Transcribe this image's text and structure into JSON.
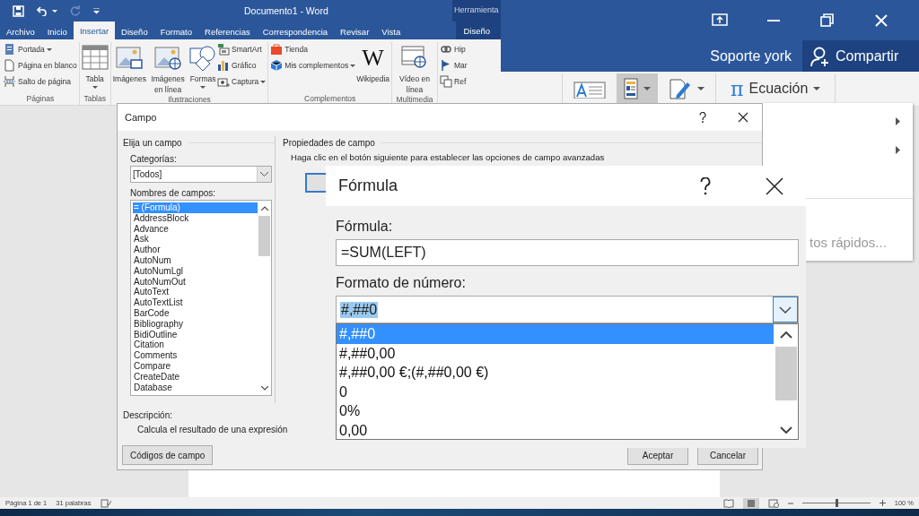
{
  "window": {
    "title": "Documento1 - Word",
    "context_group": "Herramienta"
  },
  "ribbon_tabs": [
    {
      "label": "Archivo",
      "selected": false
    },
    {
      "label": "Inicio",
      "selected": false
    },
    {
      "label": "Insertar",
      "selected": true
    },
    {
      "label": "Diseño",
      "selected": false
    },
    {
      "label": "Formato",
      "selected": false
    },
    {
      "label": "Referencias",
      "selected": false
    },
    {
      "label": "Correspondencia",
      "selected": false
    },
    {
      "label": "Revisar",
      "selected": false
    },
    {
      "label": "Vista",
      "selected": false
    },
    {
      "label": "Diseño",
      "selected": false,
      "kind": "contextual"
    }
  ],
  "account": {
    "user": "Soporte york",
    "share": "Compartir"
  },
  "ribbon_groups": [
    {
      "label": "Páginas",
      "commands": [
        {
          "label": "Portada",
          "kind": "small",
          "menu": true
        },
        {
          "label": "Página en blanco",
          "kind": "small",
          "menu": false
        },
        {
          "label": "Salto de página",
          "kind": "small",
          "menu": false
        }
      ]
    },
    {
      "label": "Tablas",
      "commands": [
        {
          "label": "Tabla",
          "kind": "large",
          "menu": true
        }
      ]
    },
    {
      "label": "Ilustraciones",
      "commands": [
        {
          "label": "Imágenes",
          "kind": "large",
          "menu": false
        },
        {
          "label": "Imágenes en línea",
          "kind": "large",
          "menu": false
        },
        {
          "label": "Formas",
          "kind": "large",
          "menu": true
        },
        {
          "label": "SmartArt",
          "kind": "small",
          "menu": false
        },
        {
          "label": "Gráfico",
          "kind": "small",
          "menu": false
        },
        {
          "label": "Captura",
          "kind": "small",
          "menu": true
        }
      ]
    },
    {
      "label": "Complementos",
      "commands": [
        {
          "label": "Tienda",
          "kind": "small",
          "menu": false
        },
        {
          "label": "Mis complementos",
          "kind": "small",
          "menu": true
        },
        {
          "label": "Wikipedia",
          "kind": "logo",
          "logo": "W",
          "menu": false
        }
      ]
    },
    {
      "label": "Multimedia",
      "commands": [
        {
          "label": "Vídeo en línea",
          "kind": "large",
          "menu": false
        }
      ]
    },
    {
      "commands": [
        {
          "label": "Hip",
          "kind": "small",
          "menu": false
        },
        {
          "label": "Mar",
          "kind": "small",
          "menu": false
        },
        {
          "label": "Ref",
          "kind": "small",
          "menu": false
        }
      ]
    }
  ],
  "equation": {
    "symbol": "π",
    "label": "Ecuación"
  },
  "side_menu": {
    "partial_item": "tos rápidos..."
  },
  "campo_dialog": {
    "title": "Campo",
    "choose_heading": "Elija un campo",
    "categories_label": "Categorías:",
    "categories_value": "[Todos]",
    "names_label": "Nombres de campos:",
    "field_names": [
      {
        "label": "= (Formula)",
        "selected": true
      },
      {
        "label": "AddressBlock",
        "selected": false
      },
      {
        "label": "Advance",
        "selected": false
      },
      {
        "label": "Ask",
        "selected": false
      },
      {
        "label": "Author",
        "selected": false
      },
      {
        "label": "AutoNum",
        "selected": false
      },
      {
        "label": "AutoNumLgl",
        "selected": false
      },
      {
        "label": "AutoNumOut",
        "selected": false
      },
      {
        "label": "AutoText",
        "selected": false
      },
      {
        "label": "AutoTextList",
        "selected": false
      },
      {
        "label": "BarCode",
        "selected": false
      },
      {
        "label": "Bibliography",
        "selected": false
      },
      {
        "label": "BidiOutline",
        "selected": false
      },
      {
        "label": "Citation",
        "selected": false
      },
      {
        "label": "Comments",
        "selected": false
      },
      {
        "label": "Compare",
        "selected": false
      },
      {
        "label": "CreateDate",
        "selected": false
      },
      {
        "label": "Database",
        "selected": false
      }
    ],
    "description_label": "Descripción:",
    "description": "Calcula el resultado de una expresión",
    "field_codes_button": "Códigos de campo",
    "properties_heading": "Propiedades de campo",
    "properties_hint": "Haga clic en el botón siguiente para establecer las opciones de campo avanzadas",
    "buttons": [
      "Aceptar",
      "Cancelar"
    ]
  },
  "formula_dialog": {
    "title": "Fórmula",
    "formula_label": "Fórmula:",
    "formula_value": "=SUM(LEFT)",
    "number_format_label": "Formato de número:",
    "number_format_value": "#,##0",
    "number_formats": [
      {
        "label": "#,##0",
        "selected": true
      },
      {
        "label": "#,##0,00",
        "selected": false
      },
      {
        "label": "#,##0,00 €;(#,##0,00 €)",
        "selected": false
      },
      {
        "label": "0",
        "selected": false
      },
      {
        "label": "0%",
        "selected": false
      },
      {
        "label": "0,00",
        "selected": false
      }
    ]
  },
  "status_bar": {
    "page": "Página 1 de 1",
    "words": "31 palabras",
    "zoom": "100 %",
    "zoom_slider": {
      "level": 0.5
    }
  }
}
